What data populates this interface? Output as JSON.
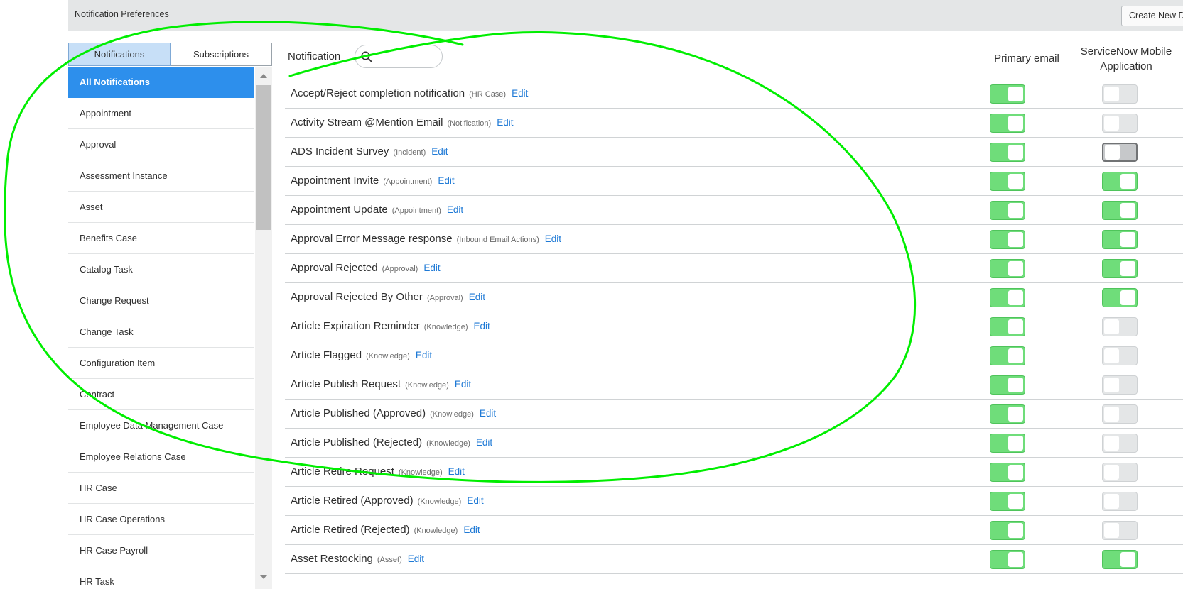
{
  "header": {
    "title": "Notification Preferences",
    "create_button": "Create New De"
  },
  "tabs": [
    {
      "label": "Notifications",
      "active": true
    },
    {
      "label": "Subscriptions",
      "active": false
    }
  ],
  "categories": [
    "All Notifications",
    "Appointment",
    "Approval",
    "Assessment Instance",
    "Asset",
    "Benefits Case",
    "Catalog Task",
    "Change Request",
    "Change Task",
    "Configuration Item",
    "Contract",
    "Employee Data Management Case",
    "Employee Relations Case",
    "HR Case",
    "HR Case Operations",
    "HR Case Payroll",
    "HR Task"
  ],
  "selected_category": "All Notifications",
  "table": {
    "notification_label": "Notification",
    "search_value": "",
    "col_primary": "Primary email",
    "col_mobile_line1": "ServiceNow Mobile",
    "col_mobile_line2": "Application",
    "edit_label": "Edit"
  },
  "rows": [
    {
      "name": "Accept/Reject completion notification",
      "type": "(HR Case)",
      "primary": "on",
      "mobile": "off"
    },
    {
      "name": "Activity Stream @Mention Email",
      "type": "(Notification)",
      "primary": "on",
      "mobile": "off"
    },
    {
      "name": "ADS Incident Survey",
      "type": "(Incident)",
      "primary": "on",
      "mobile": "off-dark"
    },
    {
      "name": "Appointment Invite",
      "type": "(Appointment)",
      "primary": "on",
      "mobile": "on"
    },
    {
      "name": "Appointment Update",
      "type": "(Appointment)",
      "primary": "on",
      "mobile": "on"
    },
    {
      "name": "Approval Error Message response",
      "type": "(Inbound Email Actions)",
      "primary": "on",
      "mobile": "on"
    },
    {
      "name": "Approval Rejected",
      "type": "(Approval)",
      "primary": "on",
      "mobile": "on"
    },
    {
      "name": "Approval Rejected By Other",
      "type": "(Approval)",
      "primary": "on",
      "mobile": "on"
    },
    {
      "name": "Article Expiration Reminder",
      "type": "(Knowledge)",
      "primary": "on",
      "mobile": "off"
    },
    {
      "name": "Article Flagged",
      "type": "(Knowledge)",
      "primary": "on",
      "mobile": "off"
    },
    {
      "name": "Article Publish Request",
      "type": "(Knowledge)",
      "primary": "on",
      "mobile": "off"
    },
    {
      "name": "Article Published (Approved)",
      "type": "(Knowledge)",
      "primary": "on",
      "mobile": "off"
    },
    {
      "name": "Article Published (Rejected)",
      "type": "(Knowledge)",
      "primary": "on",
      "mobile": "off"
    },
    {
      "name": "Article Retire Request",
      "type": "(Knowledge)",
      "primary": "on",
      "mobile": "off"
    },
    {
      "name": "Article Retired (Approved)",
      "type": "(Knowledge)",
      "primary": "on",
      "mobile": "off"
    },
    {
      "name": "Article Retired (Rejected)",
      "type": "(Knowledge)",
      "primary": "on",
      "mobile": "off"
    },
    {
      "name": "Asset Restocking",
      "type": "(Asset)",
      "primary": "on",
      "mobile": "on"
    }
  ],
  "colors": {
    "accent": "#2d8fec",
    "toggle_on": "#6fdd7a",
    "link": "#1f7ad6",
    "annotation": "#00ee00"
  },
  "icons": {
    "search": "search-icon",
    "scroll_up": "triangle-up-icon",
    "scroll_down": "triangle-down-icon"
  }
}
